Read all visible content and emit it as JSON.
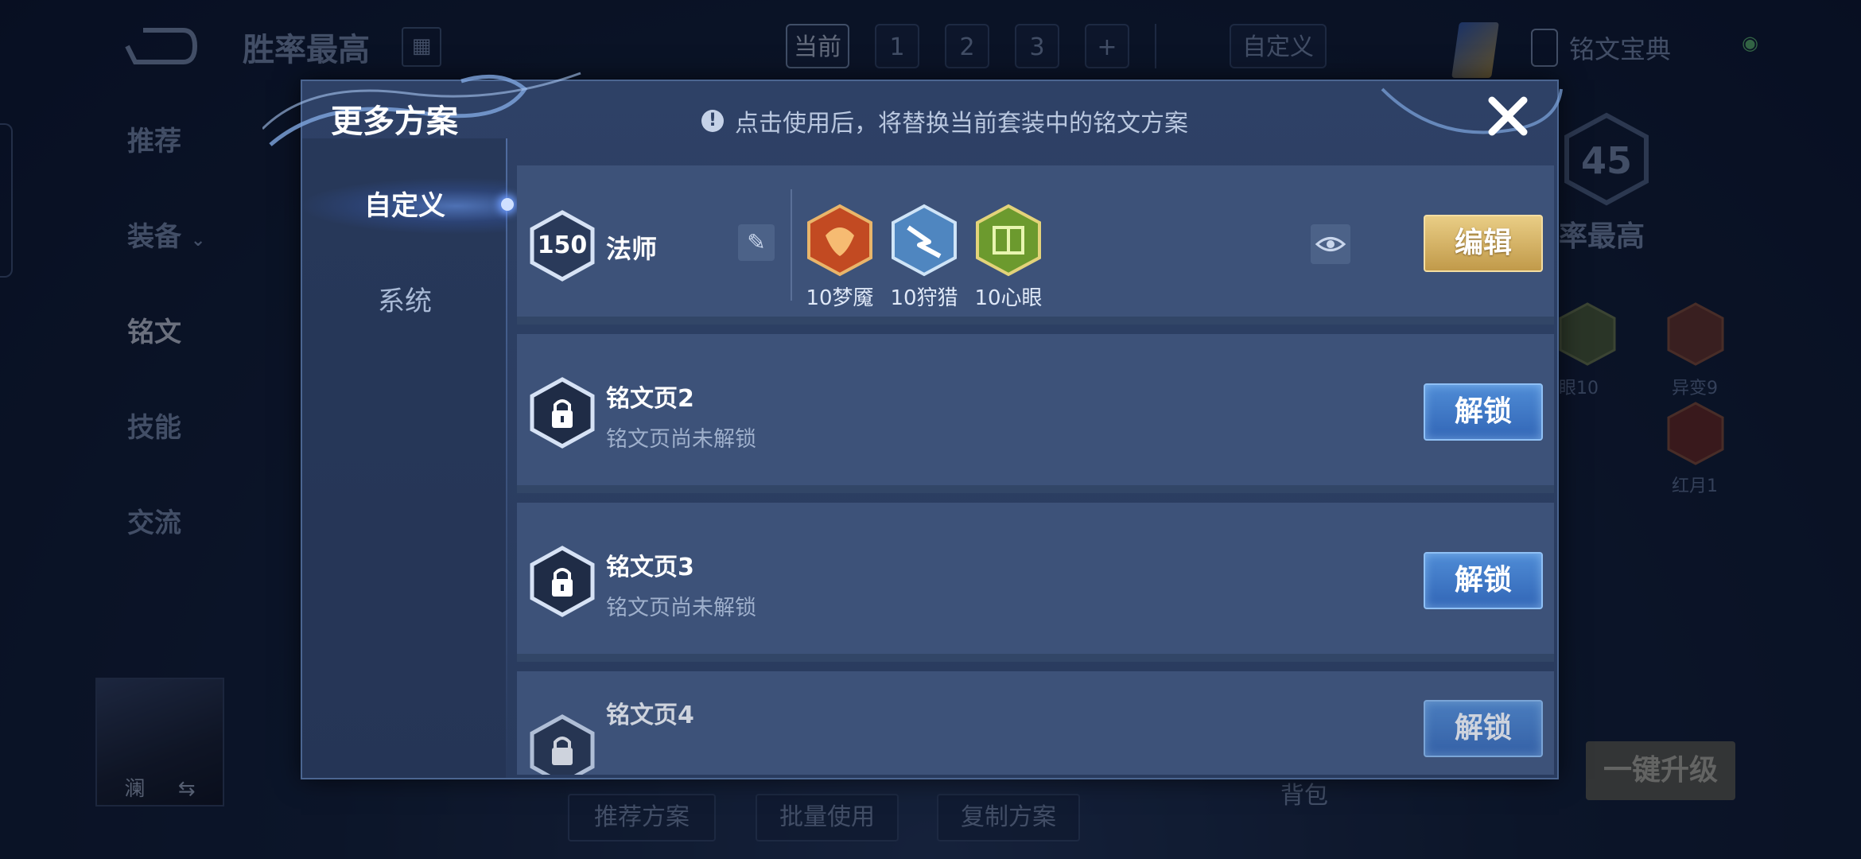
{
  "background": {
    "title": "胜率最高",
    "tabs": [
      "当前",
      "1",
      "2",
      "3",
      "+"
    ],
    "custom_tab": "自定义",
    "codex": "铭文宝典",
    "side_nav": [
      "推荐",
      "装备",
      "铭文",
      "技能",
      "交流"
    ],
    "hero_name": "澜",
    "score": "45",
    "winrate_partial": "率最高",
    "rune_labels": [
      "眼10",
      "异变9",
      "红月1"
    ],
    "bottom_buttons": [
      "推荐方案",
      "批量使用",
      "复制方案"
    ],
    "bag": "背包",
    "upgrade": "一键升级"
  },
  "modal": {
    "title": "更多方案",
    "notice": "点击使用后，将替换当前套装中的铭文方案",
    "side_tabs": [
      "自定义",
      "系统"
    ],
    "plan": {
      "level": "150",
      "name": "法师",
      "runes": [
        {
          "label": "10梦魇",
          "color": "#d8552a"
        },
        {
          "label": "10狩猎",
          "color": "#6fb3e8"
        },
        {
          "label": "10心眼",
          "color": "#7fb23a"
        }
      ],
      "edit_label": "编辑"
    },
    "locked_pages": [
      {
        "name": "铭文页2",
        "sub": "铭文页尚未解锁",
        "button": "解锁"
      },
      {
        "name": "铭文页3",
        "sub": "铭文页尚未解锁",
        "button": "解锁"
      },
      {
        "name": "铭文页4",
        "sub": "",
        "button": "解锁"
      }
    ]
  }
}
